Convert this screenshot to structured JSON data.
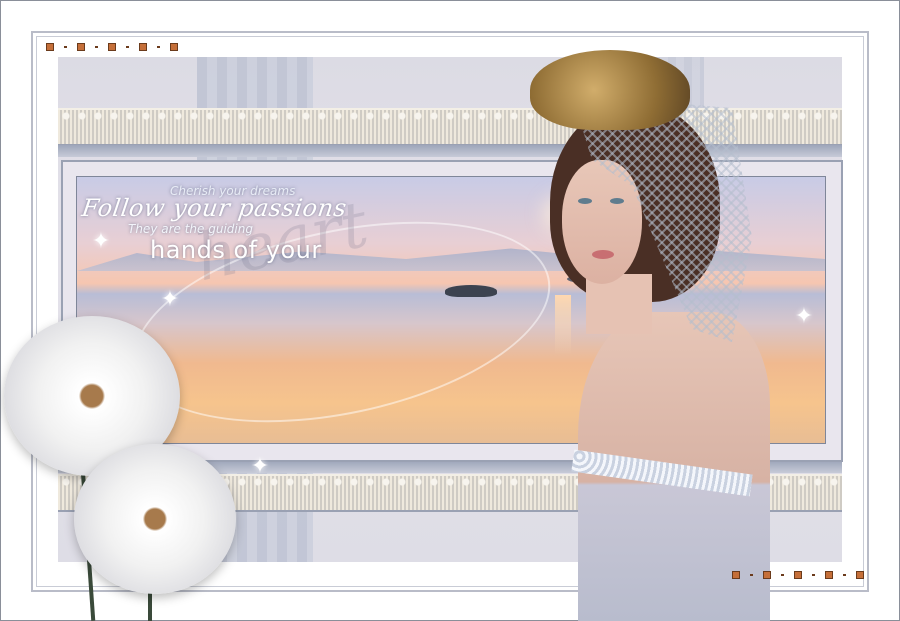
{
  "artwork": {
    "lines": {
      "line1": "Cherish your dreams",
      "line2": "Follow your passions",
      "line3": "They are the guiding",
      "line4": "hands of your",
      "line5": "heart"
    }
  },
  "colors": {
    "frame": "#b9bcc8",
    "backdrop": "#dcdbe4",
    "sunset": "#f6c48d",
    "accent_dots": "#c56f39"
  },
  "icons": {
    "sparkle": "✦"
  }
}
